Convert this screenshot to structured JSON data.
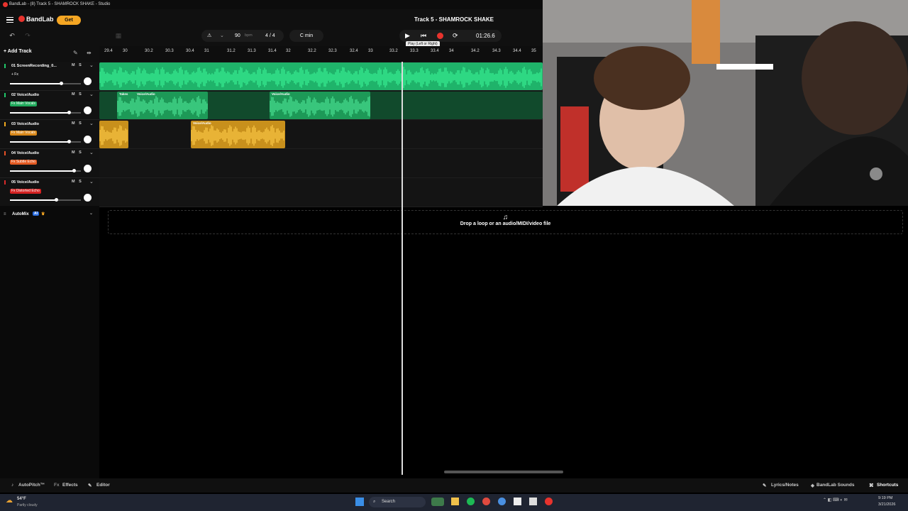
{
  "window": {
    "title": "BandLab - (8) Track 5 - SHAMROCK SHAKE - Studio"
  },
  "header": {
    "logo": "BandLab",
    "get_label": "Get",
    "project_title": "Track 5 - SHAMROCK SHAKE"
  },
  "tempo": {
    "bpm": "90",
    "bpm_unit": "bpm",
    "time_sig": "4 / 4",
    "key": "C min"
  },
  "transport": {
    "time": "01:26.6",
    "tooltip": "Play (Left or Right)"
  },
  "sidebar": {
    "add_track": "Add Track",
    "automix_label": "AutoMix",
    "automix_badge": "AI"
  },
  "ruler": [
    "29.4",
    "30",
    "30.2",
    "30.3",
    "30.4",
    "31",
    "31.2",
    "31.3",
    "31.4",
    "32",
    "32.2",
    "32.3",
    "32.4",
    "33",
    "33.2",
    "33.3",
    "33.4",
    "34",
    "34.2",
    "34.3",
    "34.4",
    "35"
  ],
  "tracks": [
    {
      "name": "01 ScreenRecording_0...",
      "fx": "+ Fx",
      "m": "M",
      "s": "S",
      "color": "#20c86a",
      "fx_color": "#121212",
      "volume": 0.72
    },
    {
      "name": "02 Voice/Audio",
      "fx": "Fx Main Vocals",
      "m": "M",
      "s": "S",
      "color": "#20c86a",
      "fx_color": "#1fa95b",
      "volume": 0.83
    },
    {
      "name": "03 Voice/Audio",
      "fx": "Fx Main Vocals",
      "m": "M",
      "s": "S",
      "color": "#f1a91f",
      "fx_color": "#d9881a",
      "volume": 0.83
    },
    {
      "name": "04 Voice/Audio",
      "fx": "Fx Subtle Echo",
      "m": "M",
      "s": "S",
      "color": "#e65126",
      "fx_color": "#e35a22",
      "volume": 0.9
    },
    {
      "name": "05 Voice/Audio",
      "fx": "Fx Distorted Echo",
      "m": "M",
      "s": "S",
      "color": "#d92a2a",
      "fx_color": "#d42222",
      "volume": 0.65
    }
  ],
  "clips": {
    "takes_label": "Takes",
    "voice_label": "Voice/Audio"
  },
  "drop_zone": {
    "text": "Drop a loop or an audio/MIDI/video file"
  },
  "bottombar": {
    "autopitch": "AutoPitch™",
    "effects": "Effects",
    "editor": "Editor",
    "lyrics": "Lyrics/Notes",
    "sounds": "BandLab Sounds",
    "shortcuts": "Shortcuts"
  },
  "taskbar": {
    "weather_temp": "54°F",
    "weather_desc": "Partly cloudy",
    "search": "Search",
    "time": "9:19 PM",
    "date": "3/21/2026"
  },
  "colors": {
    "accent_green": "#20c86a",
    "accent_yellow": "#f1a91f",
    "record_red": "#e8332d"
  }
}
